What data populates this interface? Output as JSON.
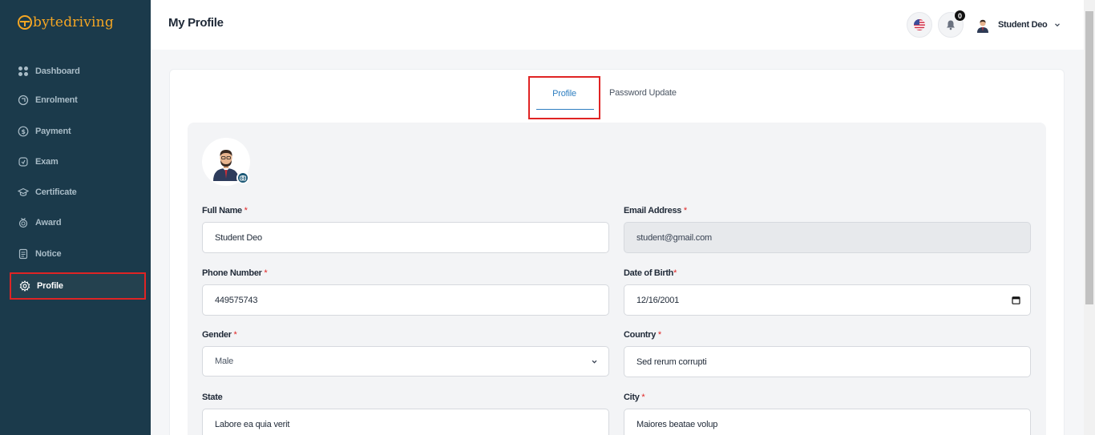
{
  "brand": {
    "name_part1": "byte",
    "name_part2": "driving"
  },
  "sidebar": {
    "items": [
      {
        "label": "Dashboard",
        "icon": "grid-icon"
      },
      {
        "label": "Enrolment",
        "icon": "enrolment-icon"
      },
      {
        "label": "Payment",
        "icon": "dollar-icon"
      },
      {
        "label": "Exam",
        "icon": "exam-icon"
      },
      {
        "label": "Certificate",
        "icon": "graduation-cap-icon"
      },
      {
        "label": "Award",
        "icon": "award-icon"
      },
      {
        "label": "Notice",
        "icon": "notice-icon"
      },
      {
        "label": "Profile",
        "icon": "gear-icon",
        "active": true
      }
    ]
  },
  "header": {
    "title": "My Profile",
    "notification_count": "0",
    "user_name": "Student Deo"
  },
  "tabs": [
    {
      "label": "Profile",
      "active": true
    },
    {
      "label": "Password Update",
      "active": false
    }
  ],
  "form": {
    "full_name": {
      "label": "Full Name",
      "required": "*",
      "value": "Student Deo"
    },
    "email": {
      "label": "Email Address",
      "required": "*",
      "value": "student@gmail.com"
    },
    "phone": {
      "label": "Phone Number",
      "required": "*",
      "value": "449575743"
    },
    "dob": {
      "label": "Date of Birth",
      "required": "*",
      "value": "12/16/2001"
    },
    "gender": {
      "label": "Gender",
      "required": "*",
      "value": "Male"
    },
    "country": {
      "label": "Country",
      "required": "*",
      "value": "Sed rerum corrupti"
    },
    "state": {
      "label": "State",
      "value": "Labore ea quia verit"
    },
    "city": {
      "label": "City",
      "required": "*",
      "value": "Maiores beatae volup"
    }
  },
  "colors": {
    "sidebar_bg": "#1b3a4b",
    "accent": "#2f7fc1",
    "brand": "#f5a623",
    "required": "#e02424"
  }
}
